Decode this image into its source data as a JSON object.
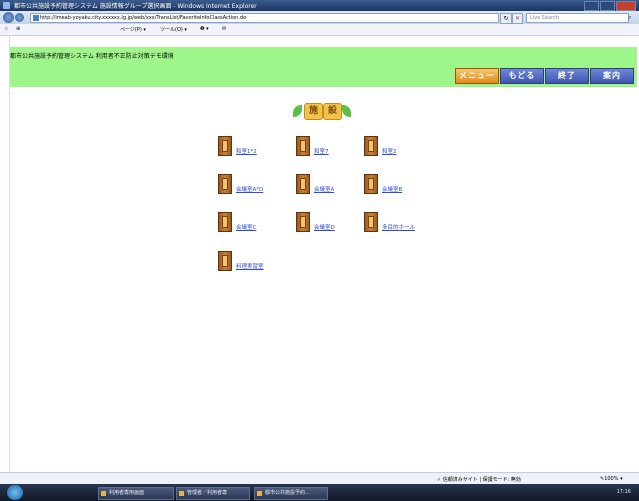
{
  "window": {
    "title": "都市公共施設予約管理システム 施設情報グループ選択画面 - Windows Internet Explorer"
  },
  "browser": {
    "url": "http://imeab-yoyaku.city.xxxxxx.lg.jp/web/xxx/TransList/FavoriteInfoClassAction.do",
    "search_placeholder": "Live Search",
    "command_items": [
      "☆",
      "⊕",
      "ページ(P) ▾",
      "ツール(O) ▾",
      "❷ ▾",
      "✉"
    ]
  },
  "page": {
    "system_caption": "都市公共施設予約管理システム 利用者不正防止対策テモ環境",
    "buttons": {
      "menu": "メニュー",
      "back": "もどる",
      "end": "終了",
      "guide": "案内"
    },
    "heading_chars": [
      "施",
      "設"
    ],
    "rooms": [
      "和室1*2",
      "和室7",
      "和室2",
      "会議室A*D",
      "会議室A",
      "会議室B",
      "会議室C",
      "会議室D",
      "多目的ホール",
      "料理実習室"
    ]
  },
  "statusbar": {
    "zone": "✓ 信頼済みサイト | 保護モード: 無効",
    "zoom": "✎100% ▾"
  },
  "taskbar": {
    "tasks": [
      "利用者専用画面",
      "管理者／利用者専",
      "都市公共施設予約..."
    ],
    "clock": "17:16"
  },
  "colors": {
    "header_green": "#9ef68a",
    "link_blue": "#2e4dd0",
    "menu_button_orange": "#e08a1a",
    "nav_button_blue": "#3e56b0"
  }
}
